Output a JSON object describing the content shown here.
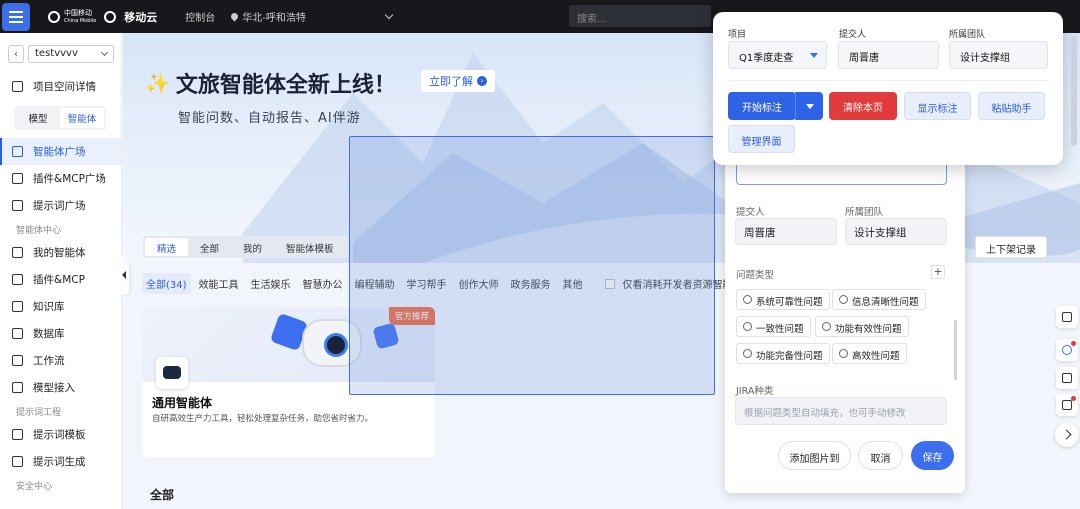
{
  "topbar": {
    "brand_cmcc": "中国移动",
    "brand_cmcc_en": "China Mobile",
    "brand_yd": "移动云",
    "console": "控制台",
    "region": "华北-呼和浩特",
    "search_placeholder": "搜索..."
  },
  "sidebar": {
    "workspace": "testvvvv",
    "project_detail": "项目空间详情",
    "seg": [
      "模型",
      "智能体"
    ],
    "items_top": [
      {
        "label": "智能体广场",
        "active": true,
        "icon": "agent-square-icon"
      },
      {
        "label": "插件&MCP广场",
        "icon": "plugin-square-icon"
      },
      {
        "label": "提示词广场",
        "icon": "prompt-square-icon"
      }
    ],
    "group1": "智能体中心",
    "items_center": [
      {
        "label": "我的智能体",
        "icon": "my-agent-icon"
      },
      {
        "label": "插件&MCP",
        "icon": "plugin-icon"
      },
      {
        "label": "知识库",
        "icon": "knowledge-icon"
      },
      {
        "label": "数据库",
        "icon": "database-icon"
      },
      {
        "label": "工作流",
        "icon": "workflow-icon"
      },
      {
        "label": "模型接入",
        "icon": "model-access-icon"
      }
    ],
    "group2": "提示词工程",
    "items_prompt": [
      {
        "label": "提示词模板",
        "icon": "prompt-template-icon"
      },
      {
        "label": "提示词生成",
        "icon": "prompt-generate-icon"
      }
    ],
    "group3": "安全中心"
  },
  "hero": {
    "title": "文旅智能体全新上线！",
    "learn_more": "立即了解",
    "subtitle": "智能问数、自动报告、AI伴游"
  },
  "tabs": [
    "精选",
    "全部",
    "我的",
    "智能体模板"
  ],
  "filters": [
    "全部(34)",
    "效能工具",
    "生活娱乐",
    "智慧办公",
    "编程辅助",
    "学习帮手",
    "创作大师",
    "政务服务",
    "其他"
  ],
  "filter_checkbox": "仅看消耗开发者资源智能体",
  "card": {
    "badge": "官方推荐",
    "title": "通用智能体",
    "desc": "自研高效生产力工具，轻松处理复杂任务，助您省时省力。"
  },
  "section_all": "全部",
  "record_button": "上下架记录",
  "form": {
    "submitter_label": "提交人",
    "submitter": "周晋唐",
    "team_label": "所属团队",
    "team": "设计支撑组",
    "issue_type_label": "问题类型",
    "issue_types": [
      "系统可靠性问题",
      "信息清晰性问题",
      "一致性问题",
      "功能有效性问题",
      "功能完备性问题",
      "高效性问题"
    ],
    "jira_label": "JIRA种类",
    "jira_placeholder": "根据问题类型自动填充，也可手动修改",
    "add_image": "添加图片到",
    "cancel": "取消",
    "save": "保存"
  },
  "annotation": {
    "project_label": "项目",
    "project": "Q1季度走查",
    "submitter_label": "提交人",
    "submitter": "周晋唐",
    "team_label": "所属团队",
    "team": "设计支撑组",
    "start": "开始标注",
    "clear": "清除本页",
    "show": "显示标注",
    "paste": "粘贴助手",
    "manage": "管理界面"
  },
  "colors": {
    "accent": "#2f63e7",
    "danger": "#e23b3b",
    "topbar": "#17181c"
  }
}
